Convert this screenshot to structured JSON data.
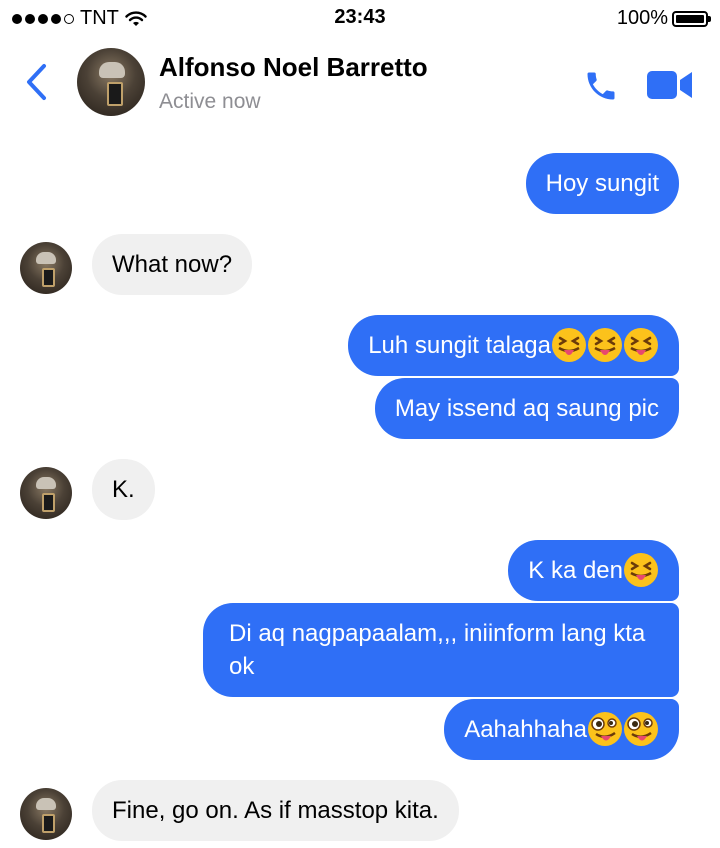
{
  "status_bar": {
    "carrier": "TNT",
    "time": "23:43",
    "battery_percent": "100%",
    "signal_bars": 4,
    "signal_total": 5
  },
  "header": {
    "contact_name": "Alfonso Noel Barretto",
    "status": "Active now",
    "accent_color": "#2f6ff6"
  },
  "messages": [
    {
      "sender": "me",
      "text": "Hoy sungit",
      "emojis": []
    },
    {
      "sender": "contact",
      "text": "What now?",
      "emojis": []
    },
    {
      "sender": "me",
      "text": "Luh sungit talaga",
      "emojis": [
        "squinting-tongue-emoji",
        "squinting-tongue-emoji",
        "squinting-tongue-emoji"
      ]
    },
    {
      "sender": "me",
      "text": "May issend aq saung pic",
      "emojis": []
    },
    {
      "sender": "contact",
      "text": "K.",
      "emojis": []
    },
    {
      "sender": "me",
      "text": "K ka den",
      "emojis": [
        "squinting-tongue-emoji"
      ]
    },
    {
      "sender": "me",
      "text": "Di aq nagpapaalam,,, iniinform lang kta ok",
      "emojis": []
    },
    {
      "sender": "me",
      "text": "Aahahhaha",
      "emojis": [
        "zany-face-emoji",
        "zany-face-emoji"
      ]
    },
    {
      "sender": "contact",
      "text": "Fine, go on. As if masstop kita.",
      "emojis": []
    }
  ],
  "colors": {
    "outgoing_bubble": "#2f6ff6",
    "incoming_bubble": "#f0f0f0",
    "muted_text": "#8e8e93"
  }
}
